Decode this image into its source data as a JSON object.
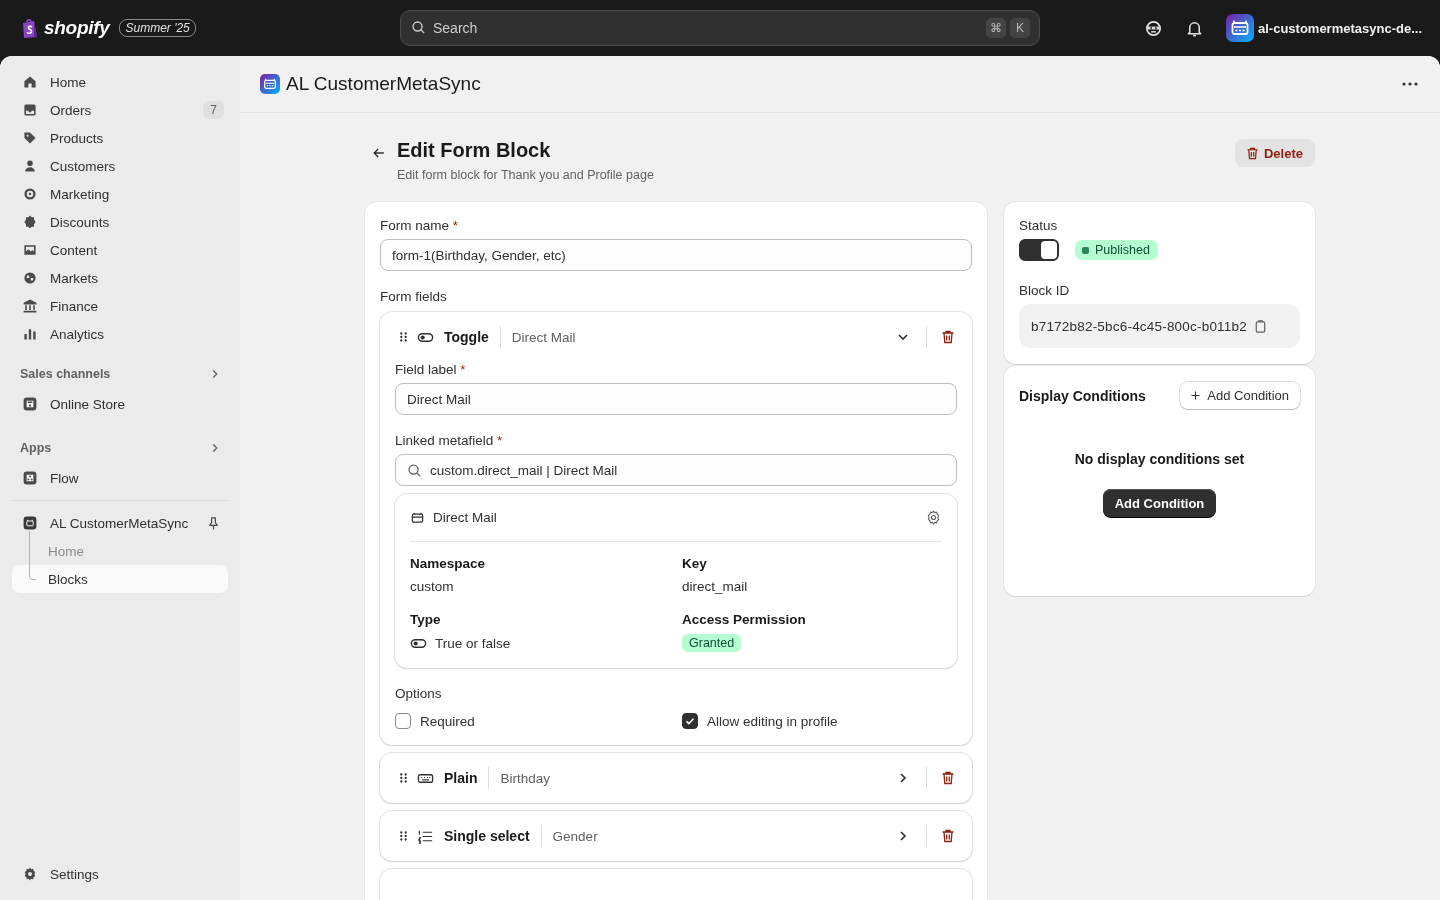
{
  "topbar": {
    "logo": "shopify",
    "edition": "Summer '25",
    "search": {
      "placeholder": "Search",
      "shortcut": [
        "⌘",
        "K"
      ]
    },
    "store": "al-customermetasync-de..."
  },
  "sidebar": {
    "items": [
      {
        "label": "Home",
        "selected": false
      },
      {
        "label": "Orders",
        "badge": "7",
        "selected": false
      },
      {
        "label": "Products",
        "selected": false
      },
      {
        "label": "Customers",
        "selected": false
      },
      {
        "label": "Marketing",
        "selected": false
      },
      {
        "label": "Discounts",
        "selected": false
      },
      {
        "label": "Content",
        "selected": false
      },
      {
        "label": "Markets",
        "selected": false
      },
      {
        "label": "Finance",
        "selected": false
      },
      {
        "label": "Analytics",
        "selected": false
      }
    ],
    "sections": [
      {
        "title": "Sales channels",
        "items": [
          {
            "label": "Online Store",
            "selected": false
          }
        ]
      },
      {
        "title": "Apps",
        "items": [
          {
            "label": "Flow",
            "selected": false
          }
        ]
      }
    ],
    "app": {
      "label": "AL CustomerMetaSync",
      "children": [
        {
          "label": "Home",
          "selected": false
        },
        {
          "label": "Blocks",
          "selected": true
        }
      ]
    },
    "settings": "Settings"
  },
  "app_header": {
    "title": "AL CustomerMetaSync"
  },
  "page": {
    "title": "Edit Form Block",
    "subtitle": "Edit form block for Thank you and Profile page",
    "delete": "Delete"
  },
  "form": {
    "form_name": {
      "label": "Form name",
      "mark": "*",
      "value": "form-1(Birthday, Gender, etc)"
    },
    "fields_label": "Form fields",
    "field_blocks": [
      {
        "kind": "toggle",
        "type": "Toggle",
        "name": "Direct Mail",
        "expanded": true,
        "field_label": {
          "label": "Field label",
          "mark": "*",
          "value": "Direct Mail"
        },
        "linked_metafield": {
          "label": "Linked metafield",
          "mark": "*",
          "value": "custom.direct_mail | Direct Mail"
        },
        "metafield": {
          "title": "Direct Mail",
          "namespace_label": "Namespace",
          "namespace": "custom",
          "key_label": "Key",
          "key": "direct_mail",
          "type_label": "Type",
          "type": "True or false",
          "access_label": "Access Permission",
          "access": "Granted"
        },
        "options_label": "Options",
        "options": [
          {
            "label": "Required",
            "checked": false
          },
          {
            "label": "Allow editing in profile",
            "checked": true
          }
        ]
      },
      {
        "kind": "plain",
        "type": "Plain",
        "name": "Birthday",
        "expanded": false
      },
      {
        "kind": "select",
        "type": "Single select",
        "name": "Gender",
        "expanded": false
      }
    ]
  },
  "status": {
    "label": "Status",
    "on": true,
    "badge": "Published"
  },
  "block_id": {
    "label": "Block ID",
    "value": "b7172b82-5bc6-4c45-800c-b011b2"
  },
  "display_conditions": {
    "title": "Display Conditions",
    "add": "Add Condition",
    "empty": "No display conditions set",
    "cta": "Add Condition"
  }
}
